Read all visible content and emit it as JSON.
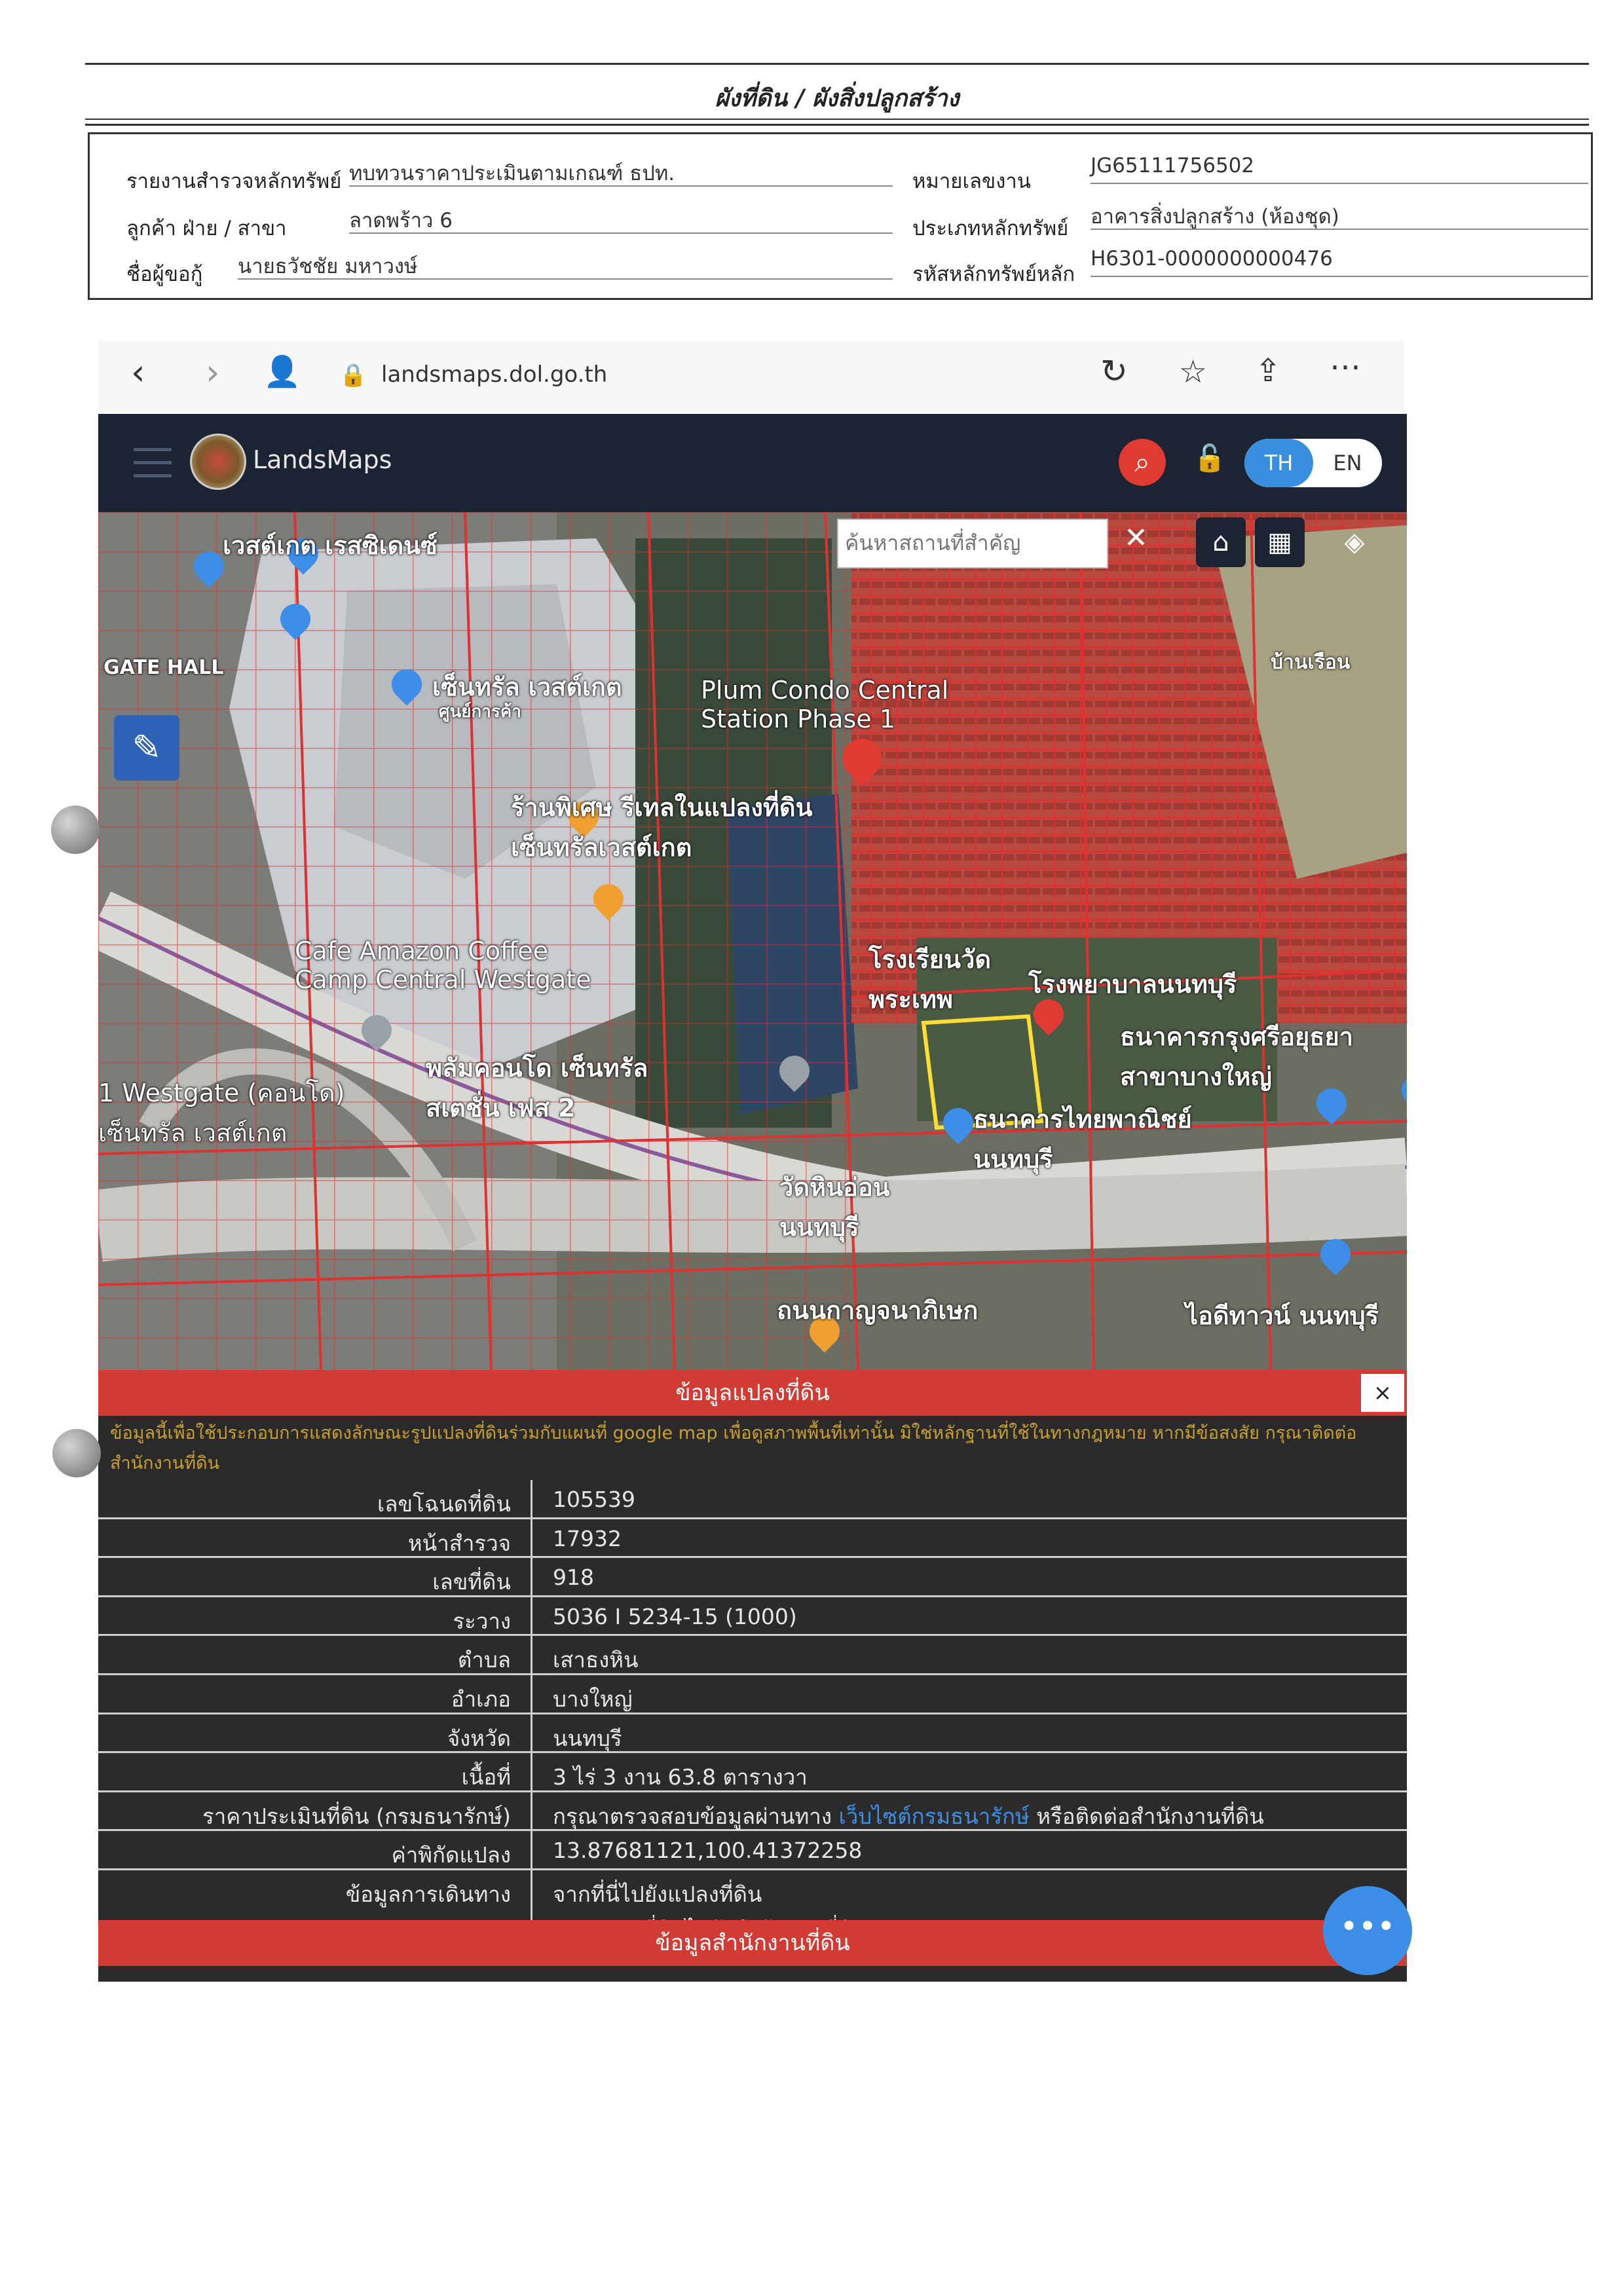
{
  "header": {
    "title": "ผังที่ดิน / ผังสิ่งปลูกสร้าง",
    "fields_left": [
      {
        "label": "รายงานสำรวจหลักทรัพย์",
        "value": "ทบทวนราคาประเมินตามเกณฑ์ ธปท."
      },
      {
        "label": "ลูกค้า ฝ่าย / สาขา",
        "value": "ลาดพร้าว 6"
      },
      {
        "label": "ชื่อผู้ขอกู้",
        "value": "นายธวัชชัย มหาวงษ์"
      }
    ],
    "fields_right": [
      {
        "label": "หมายเลขงาน",
        "value": "JG65111756502"
      },
      {
        "label": "ประเภทหลักทรัพย์",
        "value": "อาคารสิ่งปลูกสร้าง (ห้องชุด)"
      },
      {
        "label": "รหัสหลักทรัพย์หลัก",
        "value": "H6301-0000000000476"
      }
    ]
  },
  "browser": {
    "url": "landsmaps.dol.go.th",
    "back_icon": "chevron-left-icon",
    "forward_icon": "chevron-right-icon",
    "reload_icon": "reload-icon",
    "favorites_icon": "star-list-icon",
    "share_icon": "share-icon",
    "more_icon": "more-horizontal-icon"
  },
  "app": {
    "brand": "LandsMaps",
    "lang_th": "TH",
    "lang_en": "EN",
    "map_search_placeholder": "ค้นหาสถานที่สำคัญ",
    "map_labels": {
      "westgate_residence": "เวสต์เกต เรสซิเดนซ์",
      "gate_hall": "GATE HALL",
      "central_westgate": "เซ็นทรัล เวสต์เกต",
      "central_westgate_small": "ศูนย์การค้า",
      "plum_condo": "Plum Condo Central\nStation Phase 1",
      "central_dept": "ร้านพิเศษ รีเทลในแปลงที่ดิน\nเซ็นทรัลเวสต์เกต",
      "cafe_amazon": "Cafe Amazon Coffee\nCamp Central Westgate",
      "westgate_left": "1 Westgate (คอนโด)\nเซ็นทรัล เวสต์เกต",
      "plum_condo2": "พลัมคอนโด เซ็นทรัล\nสเตชั่น เฟส 2",
      "school": "โรงเรียนวัด\nพระเทพ",
      "hospital_right": "โรงพยาบาลนนทบุรี",
      "bank_sri": "ธนาคารกรุงศรีอยุธยา\nสาขาบางใหญ่",
      "bank_thai": "ธนาคารไทยพาณิชย์\nนนทบุรี",
      "wat_lin": "วัดหินอ่อน\nนนทบุรี",
      "road_kanchana": "ถนนกาญจนาภิเษก",
      "right_bottom": "ไอดีทาวน์ นนทบุรี",
      "right_top": "บ้านเรือน"
    },
    "info_title": "ข้อมูลแปลงที่ดิน",
    "disclaimer": "ข้อมูลนี้เพื่อใช้ประกอบการแสดงลักษณะรูปแปลงที่ดินร่วมกับแผนที่ google map เพื่อดูสภาพพื้นที่เท่านั้น มิใช่หลักฐานที่ใช้ในทางกฎหมาย หากมีข้อสงสัย กรุณาติดต่อสำนักงานที่ดิน",
    "rows": [
      {
        "label": "เลขโฉนดที่ดิน",
        "value": "105539"
      },
      {
        "label": "หน้าสำรวจ",
        "value": "17932"
      },
      {
        "label": "เลขที่ดิน",
        "value": "918"
      },
      {
        "label": "ระวาง",
        "value": "5036 I 5234-15 (1000)"
      },
      {
        "label": "ตำบล",
        "value": "เสาธงหิน"
      },
      {
        "label": "อำเภอ",
        "value": "บางใหญ่"
      },
      {
        "label": "จังหวัด",
        "value": "นนทบุรี"
      },
      {
        "label": "เนื้อที่",
        "value": "3 ไร่ 3 งาน 63.8 ตารางวา"
      },
      {
        "label": "ราคาประเมินที่ดิน (กรมธนารักษ์)",
        "value_pre": "กรุณาตรวจสอบข้อมูลผ่านทาง ",
        "value_link": "เว็บไซต์กรมธนารักษ์",
        "value_post": " หรือติดต่อสำนักงานที่ดิน"
      },
      {
        "label": "ค่าพิกัดแปลง",
        "value": "13.87681121,100.41372258"
      },
      {
        "label": "ข้อมูลการเดินทาง",
        "link1": "จากที่นี่ไปยังแปลงที่ดิน",
        "link2": "จากแปลงที่ดินไปยังสำนักงานที่ดิน"
      }
    ],
    "office_title": "ข้อมูลสำนักงานที่ดิน",
    "fab_label": "•••",
    "close_label": "×"
  },
  "colors": {
    "nav": "#1c2433",
    "panel_red": "#d23b34",
    "link": "#3d8ee8",
    "parcel_line": "#e03030"
  }
}
